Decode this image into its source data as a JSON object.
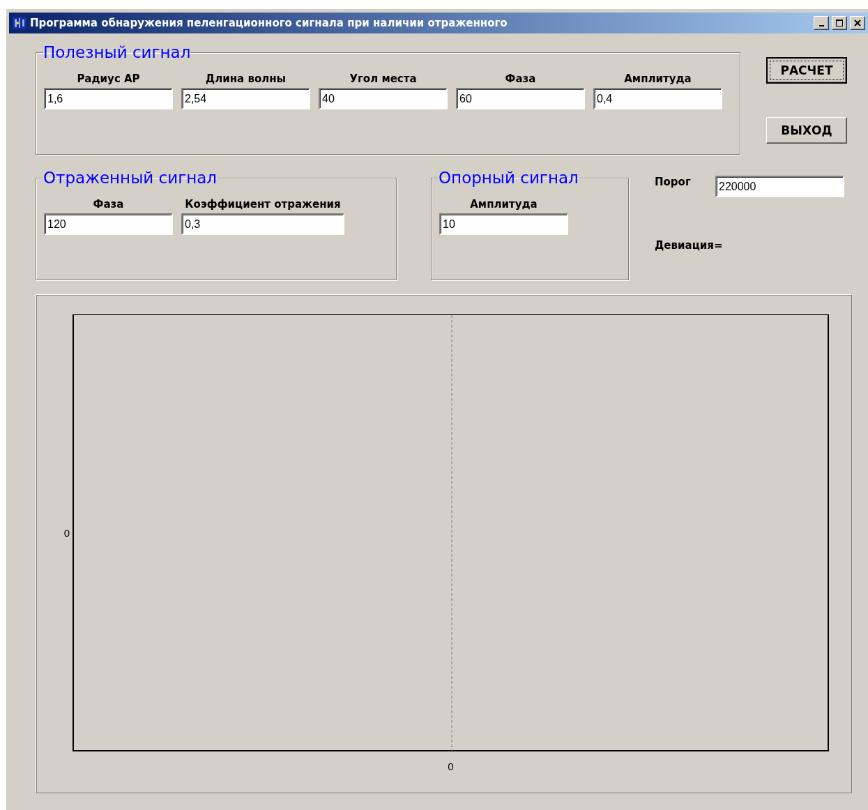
{
  "window": {
    "title": "Программа обнаружения пеленгационного сигнала при наличии отраженного"
  },
  "useful_signal": {
    "title": "Полезный сигнал",
    "fields": [
      {
        "label": "Радиус АР",
        "value": "1,6"
      },
      {
        "label": "Длина волны",
        "value": "2,54"
      },
      {
        "label": "Угол места",
        "value": "40"
      },
      {
        "label": "Фаза",
        "value": "60"
      },
      {
        "label": "Амплитуда",
        "value": "0,4"
      }
    ]
  },
  "buttons": [
    {
      "label": "РАСЧЕТ",
      "focused": true
    },
    {
      "label": "ВЫХОД",
      "focused": false
    }
  ],
  "reflected_signal": {
    "title": "Отраженный сигнал",
    "fields": [
      {
        "label": "Фаза",
        "value": "120"
      },
      {
        "label": "Коэффициент отражения",
        "value": "0,3"
      }
    ]
  },
  "reference_signal": {
    "title": "Опорный сигнал",
    "fields": [
      {
        "label": "Амплитуда",
        "value": "10"
      }
    ]
  },
  "threshold": {
    "label": "Порог",
    "value": "220000"
  },
  "deviation": {
    "label": "Девиация="
  },
  "plot": {
    "y_axis_label": "0",
    "x_axis_label": "0"
  }
}
